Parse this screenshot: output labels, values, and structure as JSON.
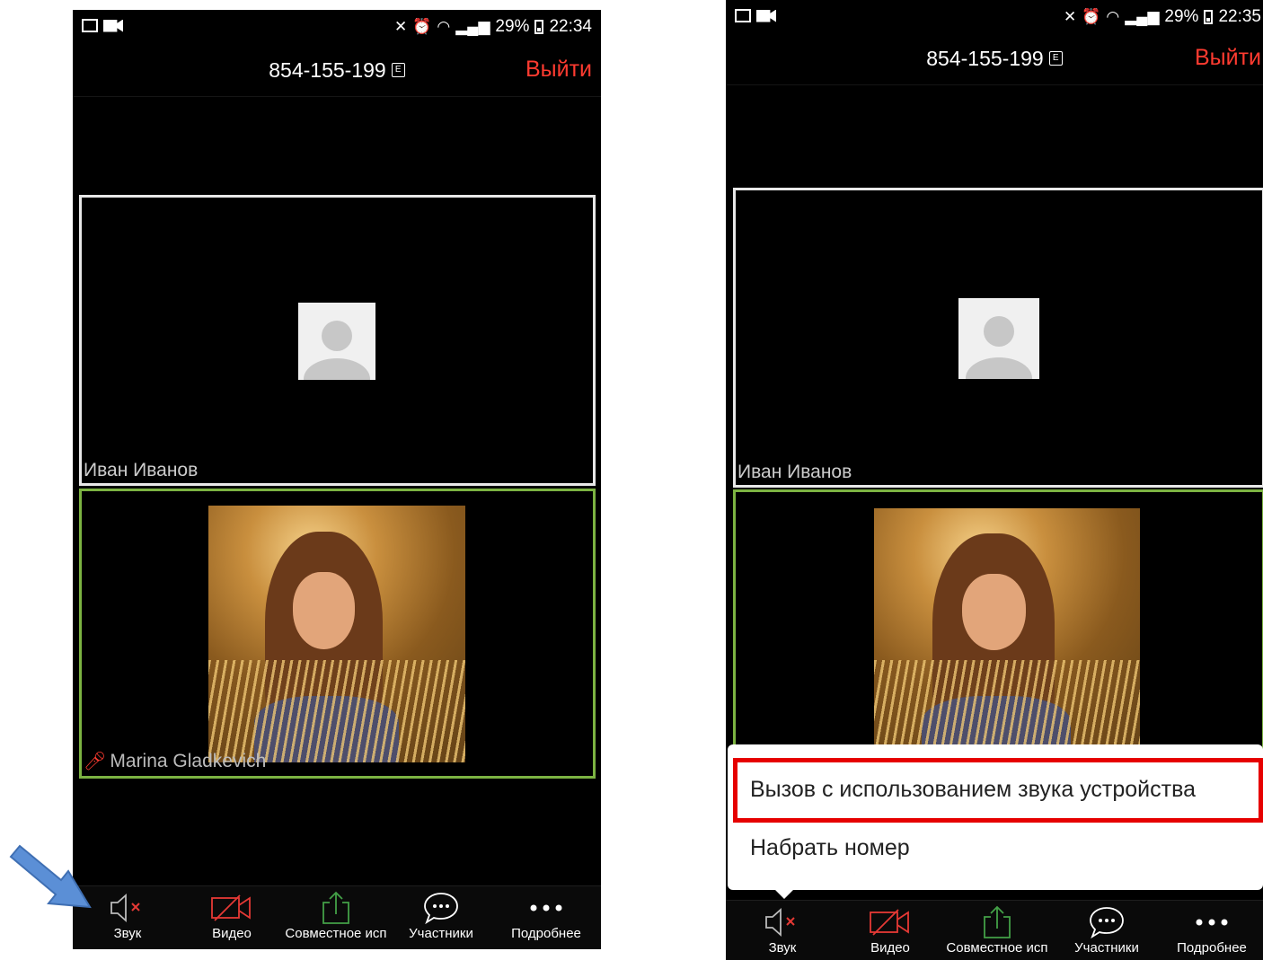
{
  "left_screen": {
    "status": {
      "battery": "29%",
      "time": "22:34"
    },
    "meeting_id": "854-155-199",
    "leave_label": "Выйти",
    "tiles": [
      {
        "name": "Иван Иванов"
      },
      {
        "name": "Marina Gladkevich"
      }
    ],
    "toolbar": [
      {
        "label": "Звук",
        "icon": "speaker-muted-icon"
      },
      {
        "label": "Видео",
        "icon": "video-off-icon"
      },
      {
        "label": "Совместное исп",
        "icon": "share-icon"
      },
      {
        "label": "Участники",
        "icon": "participants-chat-icon"
      },
      {
        "label": "Подробнее",
        "icon": "more-dots-icon"
      }
    ]
  },
  "right_screen": {
    "status": {
      "battery": "29%",
      "time": "22:35"
    },
    "meeting_id": "854-155-199",
    "leave_label": "Выйти",
    "tiles": [
      {
        "name": "Иван Иванов"
      }
    ],
    "popup": {
      "items": [
        "Вызов с использованием звука устройства",
        "Набрать номер"
      ]
    },
    "toolbar": [
      {
        "label": "Звук",
        "icon": "speaker-muted-icon"
      },
      {
        "label": "Видео",
        "icon": "video-off-icon"
      },
      {
        "label": "Совместное исп",
        "icon": "share-icon"
      },
      {
        "label": "Участники",
        "icon": "participants-chat-icon"
      },
      {
        "label": "Подробнее",
        "icon": "more-dots-icon"
      }
    ]
  },
  "colors": {
    "leave": "#ff3b30",
    "active_tile_border": "#7cb342",
    "highlight_box": "#e60000",
    "annotation_arrow": "#5b8fd6",
    "video_off_icon": "#e53935",
    "share_icon": "#43a047"
  }
}
